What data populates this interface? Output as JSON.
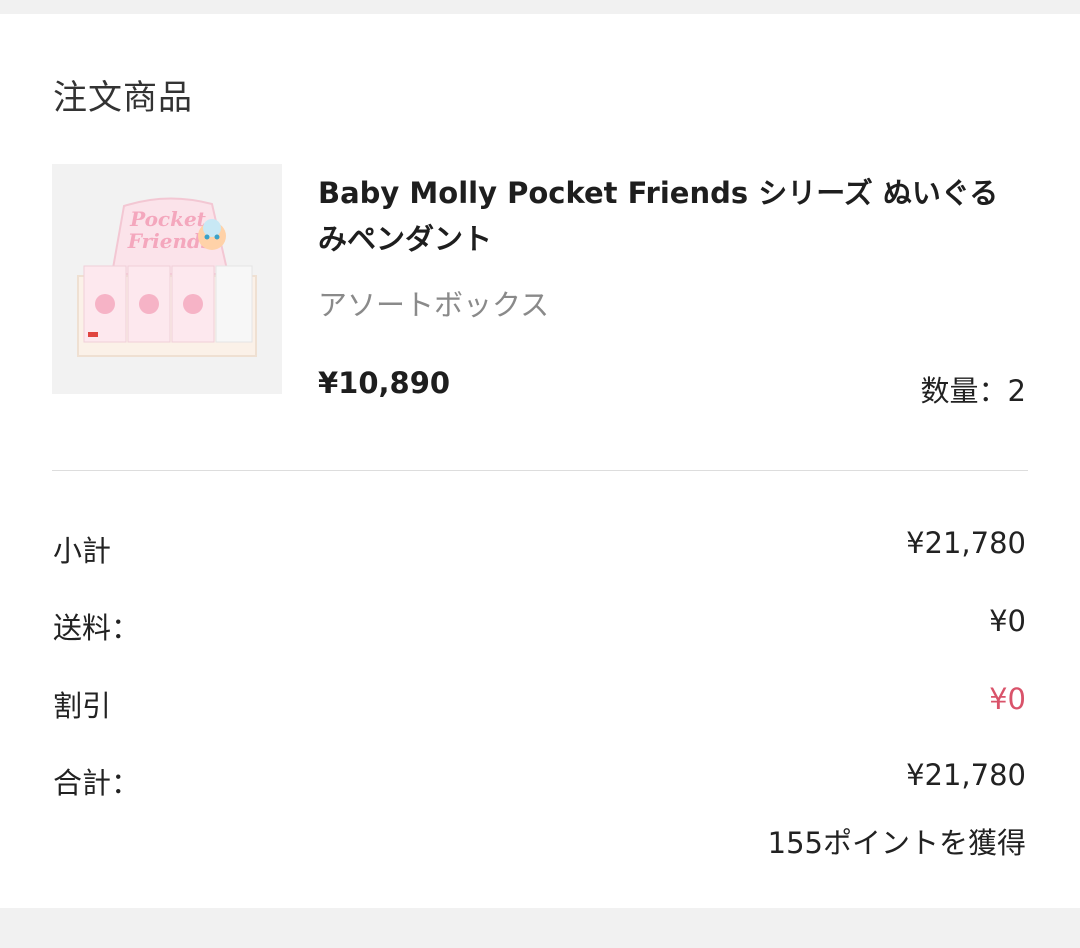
{
  "section_title": "注文商品",
  "product": {
    "name": "Baby Molly Pocket Friends シリーズ ぬいぐるみペンダント",
    "variant": "アソートボックス",
    "price": "¥10,890",
    "quantity": "数量：2",
    "image_text_line1": "Pocket",
    "image_text_line2": "Friends"
  },
  "summary": {
    "subtotal_label": "小計",
    "subtotal_value": "¥21,780",
    "shipping_label": "送料：",
    "shipping_value": "¥0",
    "discount_label": "割引",
    "discount_value": "¥0",
    "total_label": "合計：",
    "total_value": "¥21,780",
    "points": "155ポイントを獲得"
  },
  "colors": {
    "discount": "#d9536a",
    "background": "#f1f1f1"
  }
}
